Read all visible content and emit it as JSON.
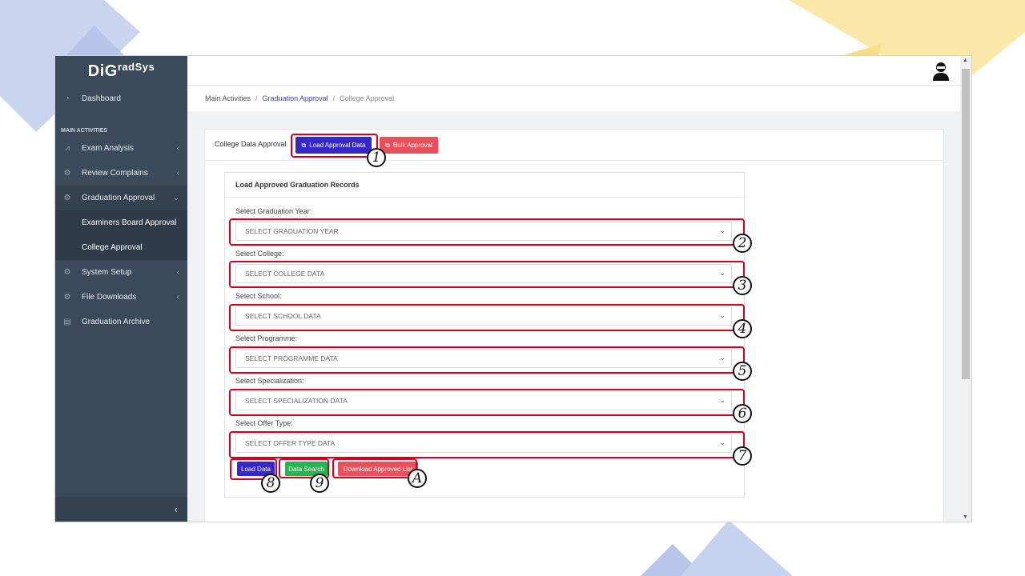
{
  "app": {
    "logo_main": "DiG",
    "logo_sup": "radSys"
  },
  "sidebar": {
    "section_label": "MAIN ACTIVITIES",
    "items": [
      {
        "label": "Dashboard",
        "icon": "dashboard-icon"
      },
      {
        "label": "Exam Analysis",
        "icon": "chart-icon"
      },
      {
        "label": "Review Complains",
        "icon": "gear-icon"
      },
      {
        "label": "Graduation Approval",
        "icon": "gear-icon"
      },
      {
        "label": "System Setup",
        "icon": "gear-icon"
      },
      {
        "label": "File Downloads",
        "icon": "gear-icon"
      },
      {
        "label": "Graduation Archive",
        "icon": "book-icon"
      }
    ],
    "sub_items": [
      {
        "label": "Examiners Board Approval"
      },
      {
        "label": "College Approval"
      }
    ],
    "collapse_glyph": "‹"
  },
  "breadcrumb": {
    "root": "Main Activities",
    "parent": "Graduation Approval",
    "current": "College Approval",
    "sep": "/"
  },
  "card": {
    "title": "College Data Approval",
    "load_approval_label": "Load Approval Data",
    "bulk_approval_label": "Bulk Approval"
  },
  "form": {
    "title": "Load Approved Graduation Records",
    "fields": [
      {
        "label": "Select Graduation Year:",
        "placeholder": "SELECT GRADUATION YEAR"
      },
      {
        "label": "Select College:",
        "placeholder": "SELECT COLLEGE DATA"
      },
      {
        "label": "Select School:",
        "placeholder": "SELECT SCHOOL DATA"
      },
      {
        "label": "Select Programme:",
        "placeholder": "SELECT PROGRAMME DATA"
      },
      {
        "label": "Select Specialization:",
        "placeholder": "SELECT SPECIALIZATION DATA"
      },
      {
        "label": "Select Offer Type:",
        "placeholder": "SELECT OFFER TYPE DATA"
      }
    ],
    "load_data_label": "Load Data",
    "data_search_label": "Data Search",
    "download_label": "Download Approved List"
  },
  "annotations": [
    "1",
    "2",
    "3",
    "4",
    "5",
    "6",
    "7",
    "8",
    "9",
    "A"
  ],
  "colors": {
    "sidebar_bg": "#3b4a5a",
    "primary": "#3527c9",
    "danger": "#e9505b",
    "success": "#27b34e",
    "highlight": "#d6001c"
  }
}
